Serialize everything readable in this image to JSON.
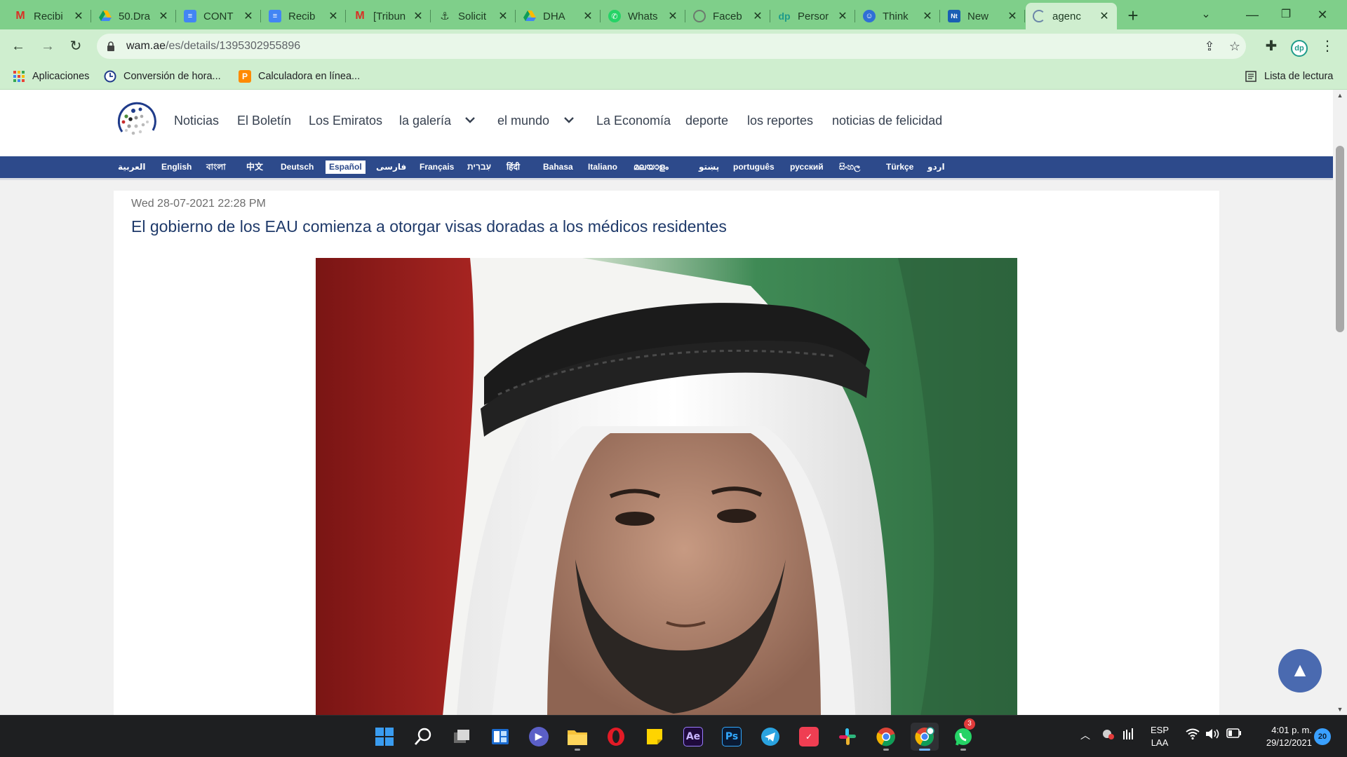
{
  "tabs": [
    {
      "title": "Recibi",
      "icon": "gmail-icon"
    },
    {
      "title": "50.Dra",
      "icon": "google-drive-icon"
    },
    {
      "title": "CONT",
      "icon": "google-docs-icon"
    },
    {
      "title": "Recib",
      "icon": "google-docs-icon"
    },
    {
      "title": "[Tribun",
      "icon": "gmail-icon"
    },
    {
      "title": "Solicit",
      "icon": "anchor-icon"
    },
    {
      "title": "DHA",
      "icon": "google-drive-icon"
    },
    {
      "title": "Whats",
      "icon": "whatsapp-icon"
    },
    {
      "title": "Faceb",
      "icon": "messenger-icon"
    },
    {
      "title": "Persor",
      "icon": "extension-dp-icon"
    },
    {
      "title": "Think",
      "icon": "thinkific-icon"
    },
    {
      "title": "New",
      "icon": "news-icon"
    },
    {
      "title": "agenc",
      "icon": "loading-icon"
    }
  ],
  "toolbar": {
    "url_host": "wam.ae",
    "url_path": "/es/details/1395302955896"
  },
  "bookmarks": [
    {
      "label": "Aplicaciones",
      "icon": "apps-grid-icon"
    },
    {
      "label": "Conversión de hora...",
      "icon": "clock-icon"
    },
    {
      "label": "Calculadora en línea...",
      "icon": "calculator-icon"
    }
  ],
  "reading_list": "Lista de lectura",
  "site": {
    "nav": [
      "Noticias",
      "El Boletín",
      "Los Emiratos",
      "la galería",
      "el mundo",
      "La Economía",
      "deporte",
      "los reportes",
      "noticias de felicidad"
    ],
    "languages": [
      "العربية",
      "English",
      "বাংলা",
      "中文",
      "Deutsch",
      "Español",
      "فارسی",
      "Français",
      "עִברִית",
      "हिंदी",
      "Bahasa",
      "Italiano",
      "മലയാളം",
      "پښتو",
      "português",
      "русский",
      "සිංහල",
      "Türkçe",
      "اردو"
    ],
    "selected_language": "Español"
  },
  "article": {
    "date": "Wed 28-07-2021 22:28 PM",
    "headline": "El gobierno de los EAU comienza a otorgar visas doradas a los médicos residentes"
  },
  "taskbar": {
    "apps": [
      "windows-start-icon",
      "search-icon",
      "task-view-icon",
      "widgets-icon",
      "teams-chat-icon",
      "file-explorer-icon",
      "opera-icon",
      "sticky-notes-icon",
      "after-effects-icon",
      "photoshop-icon",
      "telegram-icon",
      "calendar-app-icon",
      "slack-icon",
      "chrome-icon",
      "chrome-profile-icon",
      "whatsapp-icon"
    ],
    "ae_label": "Ae",
    "ps_label": "Ps",
    "whatsapp_badge": "3",
    "lang_line1": "ESP",
    "lang_line2": "LAA",
    "time": "4:01 p. m.",
    "date": "29/12/2021",
    "notifications": "20"
  }
}
